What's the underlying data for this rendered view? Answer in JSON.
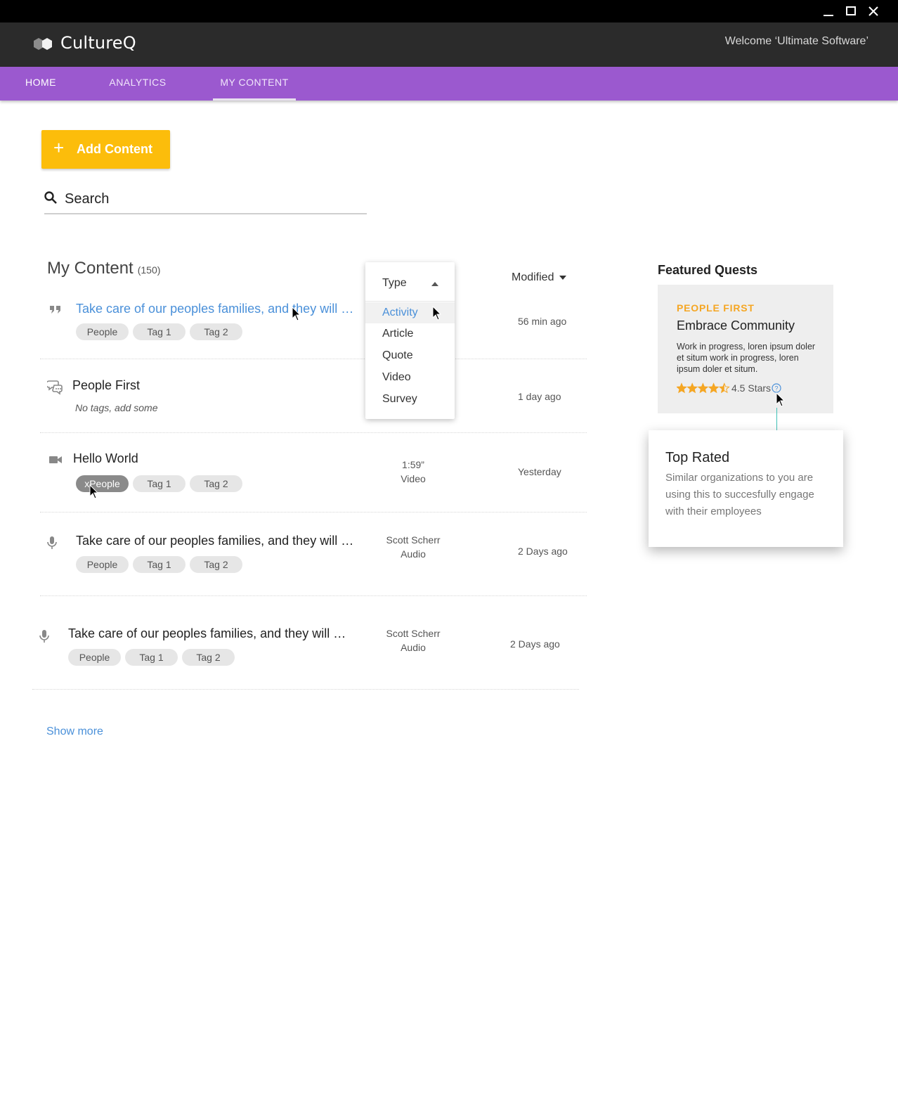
{
  "app": {
    "name": "CultureQ",
    "welcome": "Welcome ‘Ultimate Software’"
  },
  "window_controls": {
    "minimize_icon": "minimize-icon",
    "maximize_icon": "maximize-icon",
    "close_icon": "close-icon"
  },
  "nav": {
    "tabs": [
      {
        "label": "HOME"
      },
      {
        "label": "ANALYTICS"
      },
      {
        "label": "MY CONTENT",
        "active": true
      }
    ]
  },
  "toolbar": {
    "add_label": "Add Content",
    "add_color": "#fcbd0b"
  },
  "search": {
    "placeholder": "Search"
  },
  "content": {
    "title": "My Content",
    "count": "(150)",
    "sort_label": "Modified",
    "rows": [
      {
        "icon": "quote-icon",
        "title": "Take care of our peoples families, and they will …",
        "tags": [
          "People",
          "Tag 1",
          "Tag 2"
        ],
        "meta1": "",
        "meta2": "",
        "time": "56 min ago"
      },
      {
        "icon": "chat-bubbles-icon",
        "title": "People First",
        "notags": "No tags, add some",
        "tags": [],
        "meta1": "",
        "meta2": "",
        "time": "1 day ago"
      },
      {
        "icon": "video-camera-icon",
        "title": "Hello World",
        "tags": [
          "People",
          "Tag 1",
          "Tag 2"
        ],
        "remove_tag_glyph": "x",
        "meta1": "1:59”",
        "meta2": "Video",
        "time": "Yesterday"
      },
      {
        "icon": "microphone-icon",
        "title": "Take care of our peoples families, and they will …",
        "tags": [
          "People",
          "Tag 1",
          "Tag 2"
        ],
        "meta1": "Scott Scherr",
        "meta2": "Audio",
        "time": "2 Days ago"
      },
      {
        "icon": "microphone-icon",
        "title": "Take care of our peoples families, and they will …",
        "tags": [
          "People",
          "Tag 1",
          "Tag 2"
        ],
        "meta1": "Scott Scherr",
        "meta2": "Audio",
        "time": "2 Days ago"
      }
    ],
    "show_more": "Show more"
  },
  "type_dropdown": {
    "label": "Type",
    "options": [
      "Activity",
      "Article",
      "Quote",
      "Video",
      "Survey"
    ],
    "highlighted": "Activity"
  },
  "featured": {
    "title": "Featured Quests",
    "card": {
      "eyebrow": "PEOPLE FIRST",
      "title": "Embrace Community",
      "description": "Work in progress, loren ipsum doler et situm work in progress, loren ipsum doler et situm.",
      "rating": 4.5,
      "rating_max": 5,
      "rating_text": "4.5 Stars"
    },
    "tooltip": {
      "title": "Top Rated",
      "body": "Similar organizations to you are using this to succesfully engage with their employees"
    }
  },
  "colors": {
    "nav": "#9b59cf",
    "accent": "#fcbd0b",
    "link": "#4a90d9",
    "eyebrow": "#f5a623",
    "star": "#f5a623",
    "connector": "#3fc1b6"
  }
}
